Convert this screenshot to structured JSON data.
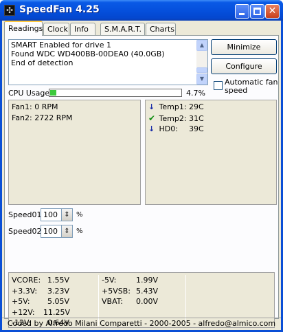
{
  "window": {
    "title": "SpeedFan 4.25"
  },
  "tabs": [
    {
      "label": "Readings"
    },
    {
      "label": "Clock"
    },
    {
      "label": "Info"
    },
    {
      "label": "S.M.A.R.T."
    },
    {
      "label": "Charts"
    }
  ],
  "log": {
    "lines": [
      "SMART Enabled for drive 1",
      "Found WDC WD400BB-00DEA0 (40.0GB)",
      "End of detection"
    ]
  },
  "buttons": {
    "minimize": "Minimize",
    "configure": "Configure"
  },
  "auto_fan": {
    "label": "Automatic fan speed",
    "checked": false
  },
  "cpu": {
    "label": "CPU Usage",
    "value_text": "4.7%",
    "value": 4.7
  },
  "fans": [
    "Fan1: 0 RPM",
    "Fan2: 2722 RPM"
  ],
  "temps": [
    {
      "name": "Temp1:",
      "value": "29C",
      "status_icon": "arrow-down-icon"
    },
    {
      "name": "Temp2:",
      "value": "31C",
      "status_icon": "checkmark-icon"
    },
    {
      "name": "HD0:",
      "value": "39C",
      "status_icon": "arrow-down-icon"
    }
  ],
  "speeds": [
    {
      "label": "Speed01:",
      "value": "100",
      "unit": "%"
    },
    {
      "label": "Speed02:",
      "value": "100",
      "unit": "%"
    }
  ],
  "voltages": {
    "col1": [
      {
        "name": "VCORE:",
        "value": "1.55V"
      },
      {
        "name": "+3.3V:",
        "value": "3.23V"
      },
      {
        "name": "+5V:",
        "value": "5.05V"
      },
      {
        "name": "+12V:",
        "value": "11.25V"
      },
      {
        "name": "-12V:",
        "value": "0.64V"
      }
    ],
    "col2": [
      {
        "name": "-5V:",
        "value": "1.99V"
      },
      {
        "name": "+5VSB:",
        "value": "5.43V"
      },
      {
        "name": "VBAT:",
        "value": "0.00V"
      }
    ]
  },
  "footer": "Coded by Alfredo Milani Comparetti - 2000-2005 - alfredo@almico.com"
}
